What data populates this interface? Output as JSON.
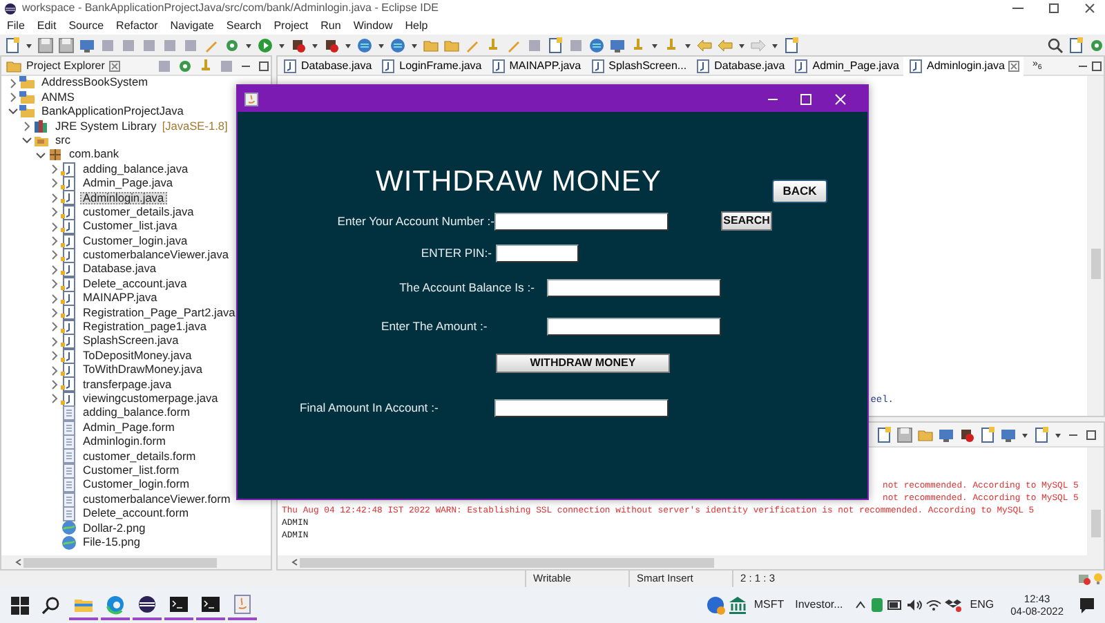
{
  "window": {
    "title": "workspace - BankApplicationProjectJava/src/com/bank/Adminlogin.java - Eclipse IDE"
  },
  "menu": [
    "File",
    "Edit",
    "Source",
    "Refactor",
    "Navigate",
    "Search",
    "Project",
    "Run",
    "Window",
    "Help"
  ],
  "project_explorer": {
    "title": "Project Explorer",
    "tree": [
      {
        "kind": "project",
        "label": "AddressBookSystem",
        "expanded": false
      },
      {
        "kind": "project",
        "label": "ANMS",
        "expanded": false
      },
      {
        "kind": "project",
        "label": "BankApplicationProjectJava",
        "expanded": true,
        "children": [
          {
            "kind": "library",
            "label": "JRE System Library",
            "decoration": "[JavaSE-1.8]",
            "expanded": false
          },
          {
            "kind": "folder",
            "label": "src",
            "expanded": true,
            "children": [
              {
                "kind": "package",
                "label": "com.bank",
                "expanded": true,
                "children": [
                  {
                    "kind": "java",
                    "label": "adding_balance.java",
                    "expanded": false,
                    "selected": false
                  },
                  {
                    "kind": "java",
                    "label": "Admin_Page.java",
                    "expanded": false,
                    "selected": false
                  },
                  {
                    "kind": "java",
                    "label": "Adminlogin.java",
                    "expanded": false,
                    "selected": true
                  },
                  {
                    "kind": "java",
                    "label": "customer_details.java",
                    "expanded": false,
                    "selected": false
                  },
                  {
                    "kind": "java",
                    "label": "Customer_list.java",
                    "expanded": false,
                    "selected": false
                  },
                  {
                    "kind": "java",
                    "label": "Customer_login.java",
                    "expanded": false,
                    "selected": false
                  },
                  {
                    "kind": "java",
                    "label": "customerbalanceViewer.java",
                    "expanded": false,
                    "selected": false
                  },
                  {
                    "kind": "java",
                    "label": "Database.java",
                    "expanded": false,
                    "selected": false
                  },
                  {
                    "kind": "java",
                    "label": "Delete_account.java",
                    "expanded": false,
                    "selected": false
                  },
                  {
                    "kind": "java",
                    "label": "MAINAPP.java",
                    "expanded": false,
                    "selected": false
                  },
                  {
                    "kind": "java",
                    "label": "Registration_Page_Part2.java",
                    "expanded": false,
                    "selected": false
                  },
                  {
                    "kind": "java",
                    "label": "Registration_page1.java",
                    "expanded": false,
                    "selected": false
                  },
                  {
                    "kind": "java",
                    "label": "SplashScreen.java",
                    "expanded": false,
                    "selected": false
                  },
                  {
                    "kind": "java",
                    "label": "ToDepositMoney.java",
                    "expanded": false,
                    "selected": false
                  },
                  {
                    "kind": "java",
                    "label": "ToWithDrawMoney.java",
                    "expanded": false,
                    "selected": false
                  },
                  {
                    "kind": "java",
                    "label": "transferpage.java",
                    "expanded": false,
                    "selected": false
                  },
                  {
                    "kind": "java",
                    "label": "viewingcustomerpage.java",
                    "expanded": false,
                    "selected": false
                  },
                  {
                    "kind": "form",
                    "label": "adding_balance.form",
                    "selected": false
                  },
                  {
                    "kind": "form",
                    "label": "Admin_Page.form",
                    "selected": false
                  },
                  {
                    "kind": "form",
                    "label": "Adminlogin.form",
                    "selected": false
                  },
                  {
                    "kind": "form",
                    "label": "customer_details.form",
                    "selected": false
                  },
                  {
                    "kind": "form",
                    "label": "Customer_list.form",
                    "selected": false
                  },
                  {
                    "kind": "form",
                    "label": "Customer_login.form",
                    "selected": false
                  },
                  {
                    "kind": "form",
                    "label": "customerbalanceViewer.form",
                    "selected": false
                  },
                  {
                    "kind": "form",
                    "label": "Delete_account.form",
                    "selected": false
                  },
                  {
                    "kind": "image",
                    "label": "Dollar-2.png",
                    "selected": false
                  },
                  {
                    "kind": "image",
                    "label": "File-15.png",
                    "selected": false
                  }
                ]
              }
            ]
          }
        ]
      }
    ]
  },
  "editor": {
    "tabs": [
      {
        "label": "Database.java",
        "selected": false
      },
      {
        "label": "LoginFrame.java",
        "selected": false
      },
      {
        "label": "MAINAPP.java",
        "selected": false
      },
      {
        "label": "SplashScreen...",
        "selected": false
      },
      {
        "label": "Database.java",
        "selected": false
      },
      {
        "label": "Admin_Page.java",
        "selected": false
      },
      {
        "label": "Adminlogin.java",
        "selected": true
      }
    ],
    "overflow": "»$_{6}$",
    "code_fragment": "eel."
  },
  "console": {
    "lines": [
      {
        "kind": "error",
        "text": "not recommended. According to MySQL 5",
        "partial": true
      },
      {
        "kind": "error",
        "text": "not recommended. According to MySQL 5",
        "partial": true
      },
      {
        "kind": "error",
        "text": "Thu Aug 04 12:42:48 IST 2022 WARN: Establishing SSL connection without server's identity verification is not recommended. According to MySQL 5",
        "partial": false
      },
      {
        "kind": "output",
        "text": "ADMIN",
        "partial": false
      },
      {
        "kind": "output",
        "text": "ADMIN",
        "partial": false
      }
    ]
  },
  "app_window": {
    "heading": "WITHDRAW MONEY",
    "back_button": "BACK",
    "rows": [
      {
        "kind": "field",
        "label": "Enter Your Account Number :-",
        "button": "SEARCH"
      },
      {
        "kind": "field",
        "label": "ENTER PIN:-"
      },
      {
        "kind": "field",
        "label": "The Account Balance Is :-"
      },
      {
        "kind": "field",
        "label": "Enter The Amount :-"
      },
      {
        "kind": "button",
        "label": "WITHDRAW MONEY"
      },
      {
        "kind": "field",
        "label": "Final Amount In Account :-"
      }
    ]
  },
  "status_bar": [
    "Writable",
    "Smart Insert",
    "2 : 1 : 3"
  ],
  "taskbar": {
    "apps": [
      {
        "kind": "start",
        "running": false
      },
      {
        "kind": "search",
        "running": false
      },
      {
        "kind": "folder",
        "running": true
      },
      {
        "kind": "browser",
        "running": true
      },
      {
        "kind": "eclipse",
        "running": true
      },
      {
        "kind": "terminal",
        "running": true
      },
      {
        "kind": "terminal",
        "running": true
      },
      {
        "kind": "java",
        "running": true
      }
    ],
    "ticker": {
      "symbol": "MSFT",
      "name": "Investor..."
    },
    "language": "ENG",
    "time": "12:43",
    "date": "04-08-2022"
  }
}
